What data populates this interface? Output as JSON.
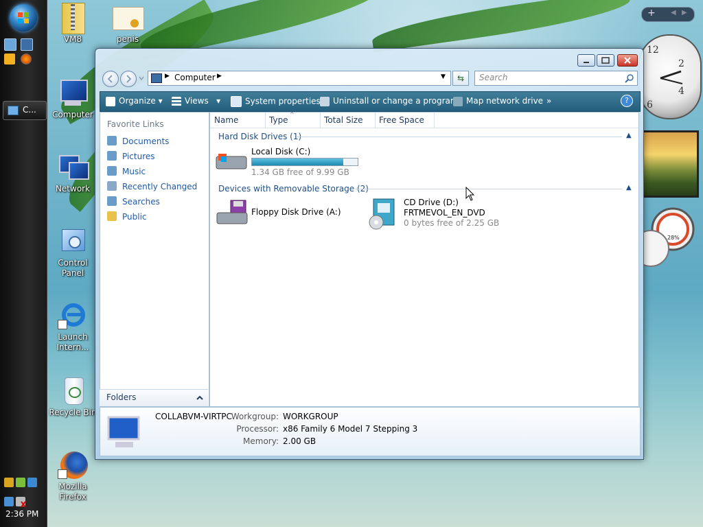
{
  "desktop": {
    "icons": [
      {
        "label": "VM8"
      },
      {
        "label": "penis"
      },
      {
        "label": "Computer"
      },
      {
        "label": "Network"
      },
      {
        "label": "Control Panel"
      },
      {
        "label": "Launch Intern..."
      },
      {
        "label": "Recycle Bin"
      },
      {
        "label": "Mozilla Firefox"
      }
    ]
  },
  "taskbar": {
    "task_button_label": "C...",
    "clock": "2:36 PM"
  },
  "gadgets": {
    "sidebar_controls": [
      "+",
      "◀",
      "▶"
    ],
    "meter_label": "28%"
  },
  "window": {
    "address": {
      "location": "Computer",
      "search_placeholder": "Search"
    },
    "toolbar": {
      "organize": "Organize",
      "views": "Views",
      "system_properties": "System properties",
      "uninstall": "Uninstall or change a program",
      "map_drive": "Map network drive",
      "more": "»",
      "help": "?"
    },
    "nav_pane": {
      "heading": "Favorite Links",
      "links": [
        "Documents",
        "Pictures",
        "Music",
        "Recently Changed",
        "Searches",
        "Public"
      ],
      "folders_label": "Folders"
    },
    "columns": [
      "Name",
      "Type",
      "Total Size",
      "Free Space"
    ],
    "groups": {
      "hard_disks": {
        "title": "Hard Disk Drives (1)",
        "items": [
          {
            "name": "Local Disk (C:)",
            "subtitle": "1.34 GB free of 9.99 GB",
            "used_fraction": 0.866
          }
        ]
      },
      "removable": {
        "title": "Devices with Removable Storage (2)",
        "items": [
          {
            "name": "Floppy Disk Drive (A:)"
          },
          {
            "name": "CD Drive (D:)",
            "label": "FRTMEVOL_EN_DVD",
            "subtitle": "0 bytes free of 2.25 GB"
          }
        ]
      }
    },
    "details": {
      "computer_name": "COLLABVM-VIRTPC",
      "workgroup_label": "Workgroup:",
      "workgroup": "WORKGROUP",
      "processor_label": "Processor:",
      "processor": "x86 Family 6 Model 7 Stepping 3",
      "memory_label": "Memory:",
      "memory": "2.00 GB"
    }
  },
  "colors": {
    "toolbar": "#2f6d8a",
    "link": "#1e5aa8",
    "progress": "#2a9ec4"
  }
}
